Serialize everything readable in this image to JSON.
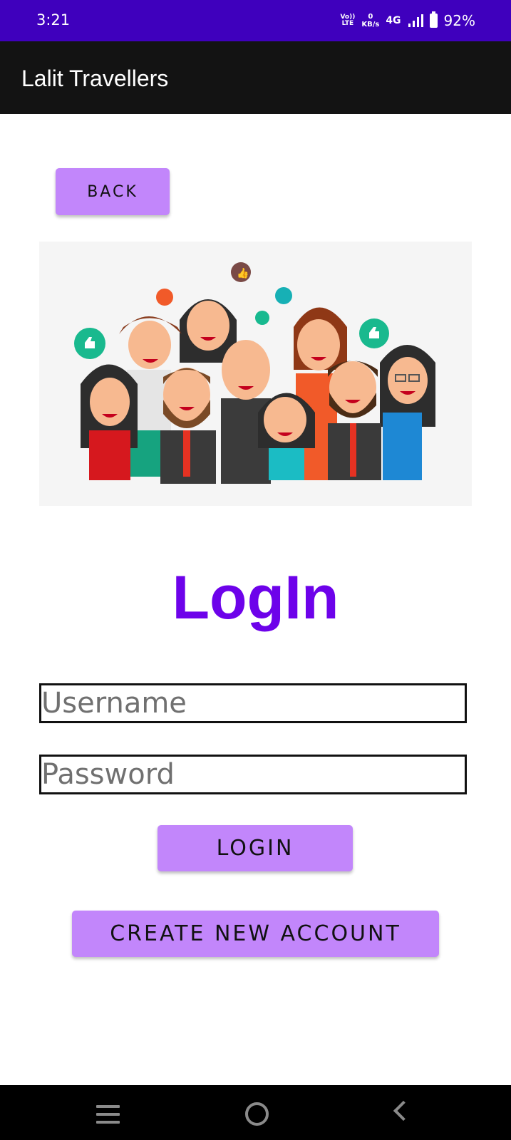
{
  "status_bar": {
    "time": "3:21",
    "volte_top": "Vo))",
    "volte_bottom": "LTE",
    "speed_value": "0",
    "speed_unit": "KB/s",
    "network": "4G",
    "battery": "92%"
  },
  "app_bar": {
    "title": "Lalit Travellers"
  },
  "back_button": {
    "label": "BACK"
  },
  "hero": {
    "icon": "group-of-people-illustration"
  },
  "form": {
    "title": "LogIn",
    "username_placeholder": "Username",
    "password_placeholder": "Password",
    "login_label": "LOGIN",
    "create_account_label": "CREATE NEW ACCOUNT"
  },
  "nav": {
    "menu_icon": "menu-icon",
    "home_icon": "home-icon",
    "back_icon": "back-icon"
  },
  "colors": {
    "status": "#3f00bd",
    "appbar": "#131313",
    "accent": "#6d02ea",
    "button": "#c286fb"
  }
}
